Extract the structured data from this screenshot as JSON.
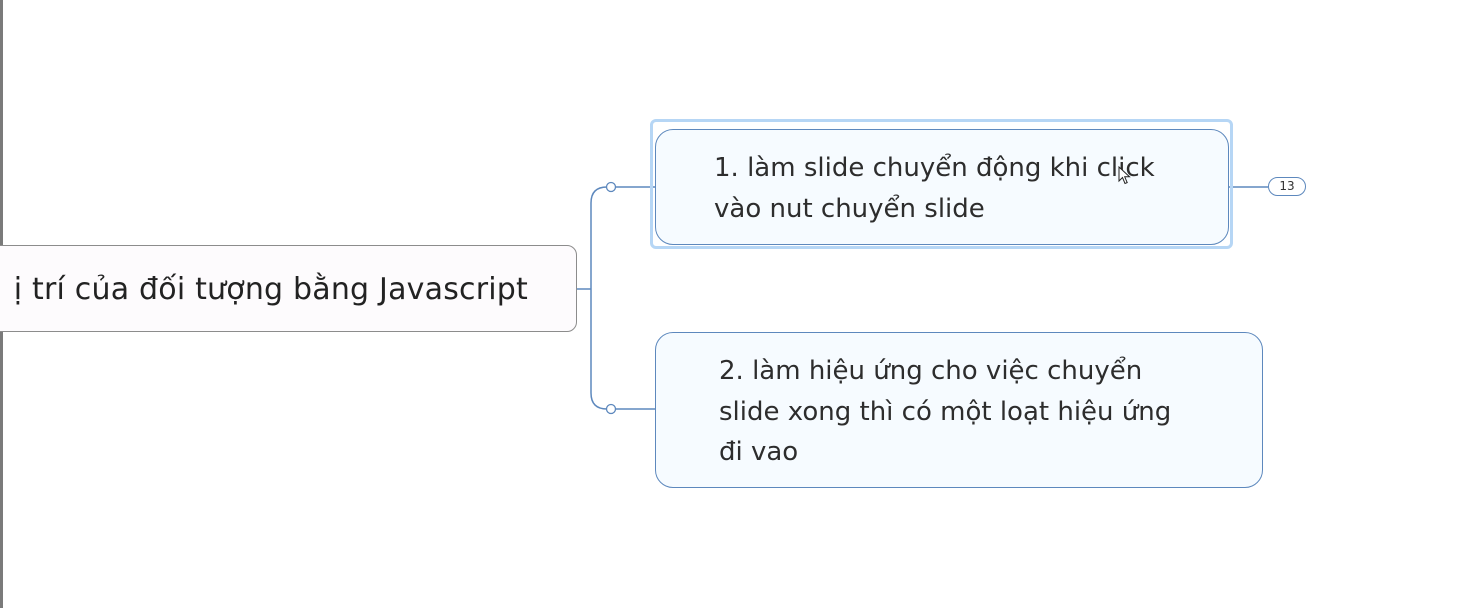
{
  "mindmap": {
    "central_topic": {
      "label": "ị trí của đối tượng bằng Javascript"
    },
    "subtopics": [
      {
        "label": "1. làm slide chuyển động khi click\nvào nut chuyển slide",
        "selected": true,
        "collapsed_count": "13"
      },
      {
        "label": "2. làm hiệu ứng cho việc chuyển\nslide xong thì có một loạt hiệu ứng\nđi vao",
        "selected": false
      }
    ],
    "colors": {
      "connector": "#5d88bd",
      "subtopic_border": "#5d88bd",
      "selection": "#b6d6f5",
      "central_border": "#8c8c8c"
    }
  }
}
